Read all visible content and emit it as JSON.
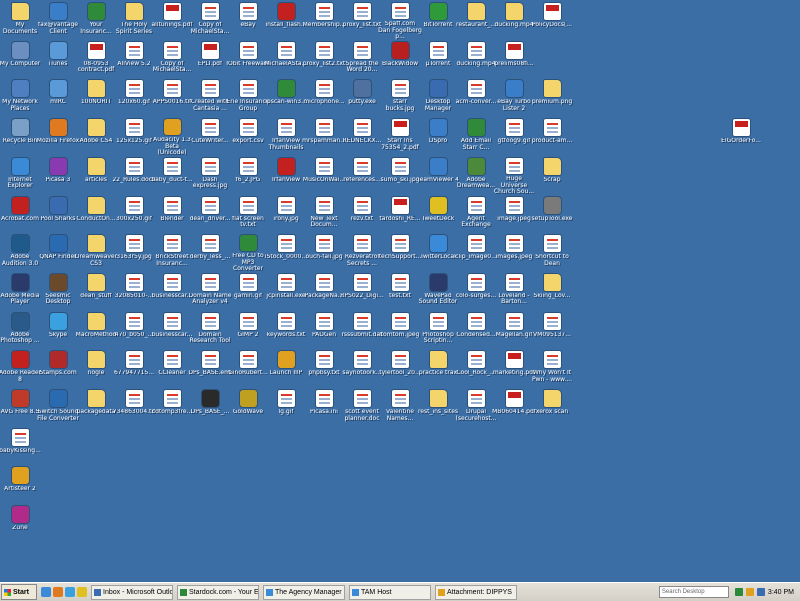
{
  "desktop": {
    "icons": [
      {
        "label": "My Documents",
        "type": "folder"
      },
      {
        "label": "fax@vantage Client",
        "type": "app",
        "color": "#3a7dc9"
      },
      {
        "label": "Your Insuranc...",
        "type": "app",
        "color": "#2f8a3a"
      },
      {
        "label": "The Holy Spirit Series",
        "type": "folder"
      },
      {
        "label": "alltunings.pdf",
        "type": "pdf"
      },
      {
        "label": "Copy of MichaelSta...",
        "type": "doc"
      },
      {
        "label": "eBay",
        "type": "doc"
      },
      {
        "label": "install_flash...",
        "type": "app",
        "color": "#c32020"
      },
      {
        "label": "Membership...",
        "type": "doc"
      },
      {
        "label": "proxy_list.txt",
        "type": "doc"
      },
      {
        "label": "Spaff.com Dan Fogelberg p...",
        "type": "doc"
      },
      {
        "label": "BitTorrent",
        "type": "app",
        "color": "#2e9a3a"
      },
      {
        "label": "restaurant_...",
        "type": "folder"
      },
      {
        "label": "ducking.mp4",
        "type": "folder"
      },
      {
        "label": "PolicyDocs[...",
        "type": "pdf"
      },
      {
        "label": "My Computer",
        "type": "app",
        "color": "#6a8fc0"
      },
      {
        "label": "iTunes",
        "type": "app",
        "color": "#5a9ad8"
      },
      {
        "label": "08-0953 contract.pdf",
        "type": "pdf"
      },
      {
        "label": "AllView 5.2",
        "type": "doc"
      },
      {
        "label": "Copy of MichaelSta...",
        "type": "doc"
      },
      {
        "label": "EPLI.pdf",
        "type": "pdf"
      },
      {
        "label": "IObit Freeware",
        "type": "doc"
      },
      {
        "label": "MichaelASta...",
        "type": "doc"
      },
      {
        "label": "proxy_list2.txt",
        "type": "doc"
      },
      {
        "label": "Spread the Word 20...",
        "type": "doc"
      },
      {
        "label": "BlackWidow",
        "type": "app",
        "color": "#b82020"
      },
      {
        "label": "µTorrent",
        "type": "doc"
      },
      {
        "label": "ducking.mp4",
        "type": "doc"
      },
      {
        "label": "prelims08fi...",
        "type": "pdf"
      },
      {
        "label": "My Network Places",
        "type": "app",
        "color": "#4f7fc0"
      },
      {
        "label": "mIRC",
        "type": "app",
        "color": "#5a9ad8"
      },
      {
        "label": "100NORIT",
        "type": "folder"
      },
      {
        "label": "120x60.gif",
        "type": "doc"
      },
      {
        "label": "APPS0016.tif",
        "type": "doc"
      },
      {
        "label": "Created with Cantasia ...",
        "type": "doc"
      },
      {
        "label": "Erie Insurance Group",
        "type": "doc"
      },
      {
        "label": "ipscan-win3...",
        "type": "app",
        "color": "#2f8a3a"
      },
      {
        "label": "microphone...",
        "type": "doc"
      },
      {
        "label": "putty.exe",
        "type": "app",
        "color": "#5070a0"
      },
      {
        "label": "starr bucks.jpg",
        "type": "doc"
      },
      {
        "label": "Desktop Manager",
        "type": "app",
        "color": "#3a6ab0"
      },
      {
        "label": "acm-conver...",
        "type": "doc"
      },
      {
        "label": "eBay Turbo Lister 2",
        "type": "app",
        "color": "#3a7dc9"
      },
      {
        "label": "premium.png",
        "type": "folder"
      },
      {
        "label": "Recycle Bin",
        "type": "app",
        "color": "#7aa0c8"
      },
      {
        "label": "Mozilla Firefox",
        "type": "app",
        "color": "#e07a20"
      },
      {
        "label": "Adobe CS4",
        "type": "folder"
      },
      {
        "label": "125x125.gif",
        "type": "doc"
      },
      {
        "label": "Audacity 1.3 Beta (Unicode)",
        "type": "app",
        "color": "#e0a020"
      },
      {
        "label": "CuteWriter...",
        "type": "doc"
      },
      {
        "label": "export.csv",
        "type": "doc"
      },
      {
        "label": "IrfanView Thumbnails",
        "type": "doc"
      },
      {
        "label": "mrspamman...",
        "type": "doc"
      },
      {
        "label": "REDNECKX...",
        "type": "doc"
      },
      {
        "label": "Starr Ins 75354_2.pdf",
        "type": "pdf"
      },
      {
        "label": "DSpro",
        "type": "app",
        "color": "#3a7dc9"
      },
      {
        "label": "Add Email Starr C...",
        "type": "app",
        "color": "#2f8a3a"
      },
      {
        "label": "gtfoog9.gif",
        "type": "doc"
      },
      {
        "label": "product-am...",
        "type": "doc"
      },
      {
        "label": "EIGOrderFo...",
        "type": "pdf"
      },
      {
        "label": "Internet Explorer",
        "type": "app",
        "color": "#3a8ad8"
      },
      {
        "label": "Picasa 3",
        "type": "app",
        "color": "#8a3ab0"
      },
      {
        "label": "articles",
        "type": "folder"
      },
      {
        "label": "22_Rules.docx",
        "type": "doc"
      },
      {
        "label": "baby_duct-t...",
        "type": "doc"
      },
      {
        "label": "Dash express.jpg",
        "type": "doc"
      },
      {
        "label": "f6_2.JPG",
        "type": "doc"
      },
      {
        "label": "IrfanView",
        "type": "app",
        "color": "#c32020"
      },
      {
        "label": "MusicOnWai...",
        "type": "doc"
      },
      {
        "label": "references...",
        "type": "doc"
      },
      {
        "label": "sumo_ski.jpg",
        "type": "doc"
      },
      {
        "label": "TeamViewer 4",
        "type": "app",
        "color": "#3a7dc9"
      },
      {
        "label": "Adobe Dreamwea...",
        "type": "app",
        "color": "#4a8a3a"
      },
      {
        "label": "Huge Universe Church Sou...",
        "type": "doc"
      },
      {
        "label": "Scrap",
        "type": "folder"
      },
      {
        "label": "Acrobat.com",
        "type": "app",
        "color": "#c32020"
      },
      {
        "label": "Pool Sharks",
        "type": "app",
        "color": "#3a6ab0"
      },
      {
        "label": "ConductOn...",
        "type": "folder"
      },
      {
        "label": "300x250.gif",
        "type": "doc"
      },
      {
        "label": "Blender",
        "type": "doc"
      },
      {
        "label": "dean_driver...",
        "type": "doc"
      },
      {
        "label": "flat screen tv.txt",
        "type": "doc"
      },
      {
        "label": "irony.jpg",
        "type": "doc"
      },
      {
        "label": "New Text Docum...",
        "type": "doc"
      },
      {
        "label": "rezv.txt",
        "type": "doc"
      },
      {
        "label": "tardoshi_RE...",
        "type": "pdf"
      },
      {
        "label": "TweetDeck",
        "type": "app",
        "color": "#e0c020"
      },
      {
        "label": "Agent Exchange",
        "type": "doc"
      },
      {
        "label": "image.jpeg",
        "type": "doc"
      },
      {
        "label": "setupTool.exe",
        "type": "app",
        "color": "#7a7a7a"
      },
      {
        "label": "Adobe Audition 3.0",
        "type": "app",
        "color": "#1f5a8a"
      },
      {
        "label": "QNAP Finder",
        "type": "app",
        "color": "#2a6ab0"
      },
      {
        "label": "Dreamweaver CS3",
        "type": "folder"
      },
      {
        "label": "3163r5y.jpg",
        "type": "doc"
      },
      {
        "label": "BrickStreet Insuranc...",
        "type": "doc"
      },
      {
        "label": "derby_less_...",
        "type": "doc"
      },
      {
        "label": "Free CD to MP3 Converter",
        "type": "app",
        "color": "#2f8a3a"
      },
      {
        "label": "iStock_0000...",
        "type": "doc"
      },
      {
        "label": "ouch-fail.jpg",
        "type": "doc"
      },
      {
        "label": "Rezveratrol Secrets ...",
        "type": "doc"
      },
      {
        "label": "techSupport...",
        "type": "doc"
      },
      {
        "label": "TwitterLocal",
        "type": "app",
        "color": "#3a8ad8"
      },
      {
        "label": "clip_image0...",
        "type": "doc"
      },
      {
        "label": "images.jpeg",
        "type": "doc"
      },
      {
        "label": "Shortcut to Dean",
        "type": "doc"
      },
      {
        "label": "Adobe Media Player",
        "type": "app",
        "color": "#2a3a6a"
      },
      {
        "label": "Seesmic Desktop",
        "type": "app",
        "color": "#6a4a2a"
      },
      {
        "label": "dean_stuff",
        "type": "folder"
      },
      {
        "label": "32085010-...",
        "type": "doc"
      },
      {
        "label": "businesscar...",
        "type": "doc"
      },
      {
        "label": "Domain Name Analyzer v4",
        "type": "doc"
      },
      {
        "label": "gamin.gif",
        "type": "doc"
      },
      {
        "label": "jcpinstall.exe",
        "type": "doc"
      },
      {
        "label": "PackageNa...",
        "type": "doc"
      },
      {
        "label": "RPS022_Digi...",
        "type": "doc"
      },
      {
        "label": "test.txt",
        "type": "doc"
      },
      {
        "label": "WavePad Sound Editor",
        "type": "app",
        "color": "#2a3a6a"
      },
      {
        "label": "colo-surges...",
        "type": "doc"
      },
      {
        "label": "Loveland - Barton...",
        "type": "doc"
      },
      {
        "label": "Skiing_Lov...",
        "type": "folder"
      },
      {
        "label": "Adobe Photoshop ...",
        "type": "app",
        "color": "#2a5a8a"
      },
      {
        "label": "Skype",
        "type": "app",
        "color": "#3aa0e0"
      },
      {
        "label": "MacroMethod",
        "type": "folder"
      },
      {
        "label": "470_b050_...",
        "type": "doc"
      },
      {
        "label": "businesscar...",
        "type": "doc"
      },
      {
        "label": "Domain Research Tool",
        "type": "doc"
      },
      {
        "label": "GIMP 2",
        "type": "doc"
      },
      {
        "label": "keywords.txt",
        "type": "doc"
      },
      {
        "label": "PADGen",
        "type": "doc"
      },
      {
        "label": "rsssubmit.dat",
        "type": "doc"
      },
      {
        "label": "tomtom.jpeg",
        "type": "doc"
      },
      {
        "label": "Photoshop Scriptin...",
        "type": "doc"
      },
      {
        "label": "Condensed...",
        "type": "doc"
      },
      {
        "label": "Magellan.gif",
        "type": "doc"
      },
      {
        "label": "VM095137...",
        "type": "doc"
      },
      {
        "label": "Adobe Reader 8",
        "type": "app",
        "color": "#c32020"
      },
      {
        "label": "Stamps.com",
        "type": "app",
        "color": "#b02a2a"
      },
      {
        "label": "nogle",
        "type": "folder"
      },
      {
        "label": "677947715...",
        "type": "doc"
      },
      {
        "label": "CCleaner",
        "type": "doc"
      },
      {
        "label": "DPs_BASE.eml",
        "type": "doc"
      },
      {
        "label": "GinoRubert...",
        "type": "doc"
      },
      {
        "label": "Launch IIIP",
        "type": "app",
        "color": "#e0a020"
      },
      {
        "label": "phpbsy.txt",
        "type": "doc"
      },
      {
        "label": "saynotoork...",
        "type": "doc"
      },
      {
        "label": "tylertool_20...",
        "type": "doc"
      },
      {
        "label": "practice trax",
        "type": "folder"
      },
      {
        "label": "Cool_Rock_...",
        "type": "doc"
      },
      {
        "label": "marketing.pdf",
        "type": "pdf"
      },
      {
        "label": "Why Won't It Pwn - www....",
        "type": "doc"
      },
      {
        "label": "AVG Free 8.5",
        "type": "app",
        "color": "#c03a2a"
      },
      {
        "label": "Switch Sound File Converter",
        "type": "app",
        "color": "#2a6ab0"
      },
      {
        "label": "packagedata",
        "type": "folder"
      },
      {
        "label": "734863004.tif",
        "type": "doc"
      },
      {
        "label": "cdtomp3fre...",
        "type": "doc"
      },
      {
        "label": "DPs_BASE_...",
        "type": "app",
        "color": "#2a2a2a"
      },
      {
        "label": "GoldWave",
        "type": "app",
        "color": "#c0a020"
      },
      {
        "label": "lg.gif",
        "type": "doc"
      },
      {
        "label": "Picasa.ini",
        "type": "doc"
      },
      {
        "label": "scott event planner.doc",
        "type": "doc"
      },
      {
        "label": "Valentine Names...",
        "type": "doc"
      },
      {
        "label": "rest_ins_sites",
        "type": "folder"
      },
      {
        "label": "Drupal (securehost...",
        "type": "doc"
      },
      {
        "label": "MB060414.pdf",
        "type": "pdf"
      },
      {
        "label": "xerox scan",
        "type": "folder"
      },
      {
        "label": "babyKissing...",
        "type": "doc"
      },
      {
        "label": "Artisteer 2",
        "type": "app",
        "color": "#e0a020"
      },
      {
        "label": "Zune",
        "type": "app",
        "color": "#b02a8a"
      }
    ]
  },
  "taskbar": {
    "start_label": "Start",
    "tasks": [
      {
        "label": "Inbox - Microsoft Outlook",
        "color": "#3a6ab0"
      },
      {
        "label": "Stardock.com - Your Edg...",
        "color": "#2a8a3a"
      },
      {
        "label": "The Agency Manager",
        "color": "#3a8ad8"
      },
      {
        "label": "TAM Host",
        "color": "#3a8ad8"
      },
      {
        "label": "Attachment: DIPPYS",
        "color": "#e0a020"
      }
    ],
    "search_placeholder": "Search Desktop",
    "clock": "3:40 PM"
  }
}
